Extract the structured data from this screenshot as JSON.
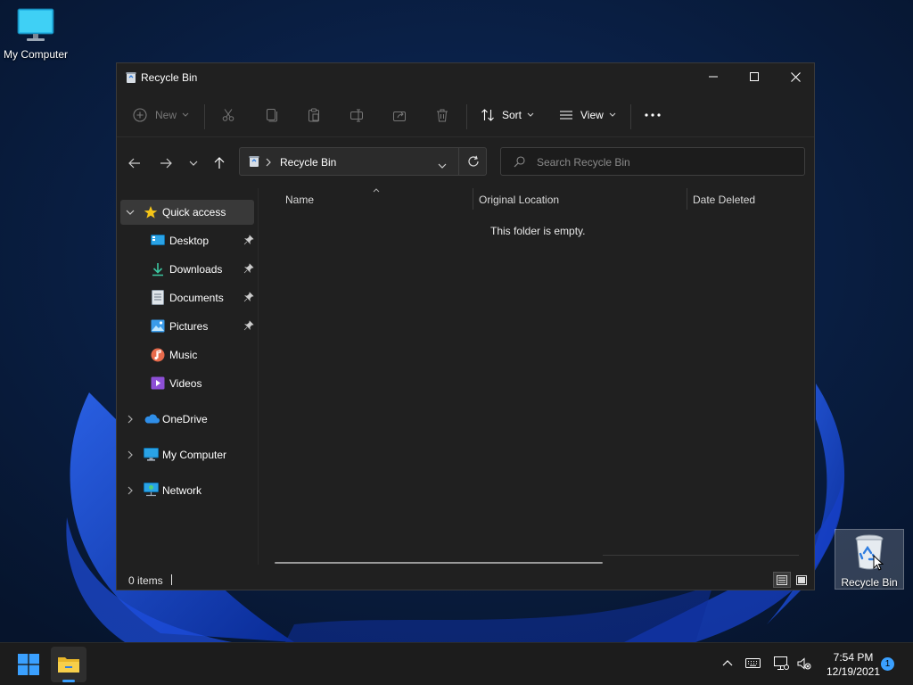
{
  "desktop": {
    "icons": [
      {
        "label": "My Computer"
      },
      {
        "label": "Recycle Bin"
      }
    ]
  },
  "window": {
    "title": "Recycle Bin",
    "toolbar": {
      "new_label": "New",
      "sort_label": "Sort",
      "view_label": "View"
    },
    "address": {
      "path": "Recycle Bin"
    },
    "search": {
      "placeholder": "Search Recycle Bin"
    },
    "nav_pane": {
      "quick_access": "Quick access",
      "pinned": [
        "Desktop",
        "Downloads",
        "Documents",
        "Pictures"
      ],
      "unpinned": [
        "Music",
        "Videos"
      ],
      "roots": [
        "OneDrive",
        "My Computer",
        "Network"
      ]
    },
    "columns": [
      "Name",
      "Original Location",
      "Date Deleted"
    ],
    "empty_message": "This folder is empty.",
    "status": {
      "item_count": "0 items"
    }
  },
  "taskbar": {
    "clock_time": "7:54 PM",
    "clock_date": "12/19/2021",
    "notification_count": "1"
  },
  "colors": {
    "accent": "#3aa0ff",
    "window_bg": "#202020",
    "selected_bg": "#393939"
  }
}
